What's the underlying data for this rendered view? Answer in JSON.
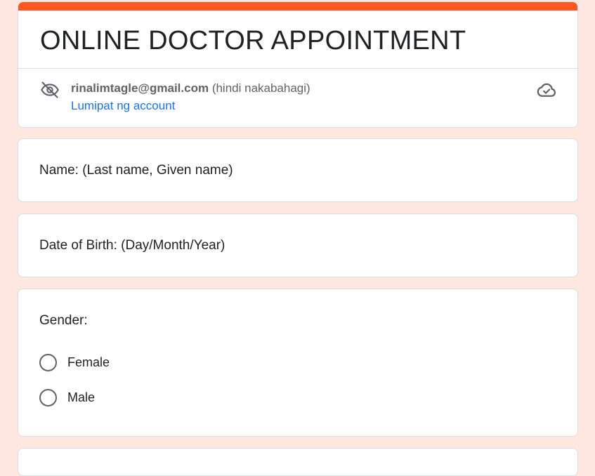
{
  "form": {
    "title": "ONLINE DOCTOR APPOINTMENT",
    "accent_color": "#ff5722"
  },
  "account": {
    "email": "rinalimtagle@gmail.com",
    "sharing_note": "(hindi nakabahagi)",
    "switch_label": "Lumipat ng account",
    "privacy_icon": "eye-off-icon",
    "save_status_icon": "cloud-check-icon"
  },
  "questions": {
    "name": {
      "label": "Name: (Last name, Given name)"
    },
    "dob": {
      "label": "Date of Birth: (Day/Month/Year)"
    },
    "gender": {
      "label": "Gender:",
      "options": [
        {
          "label": "Female",
          "selected": false
        },
        {
          "label": "Male",
          "selected": false
        }
      ]
    }
  }
}
